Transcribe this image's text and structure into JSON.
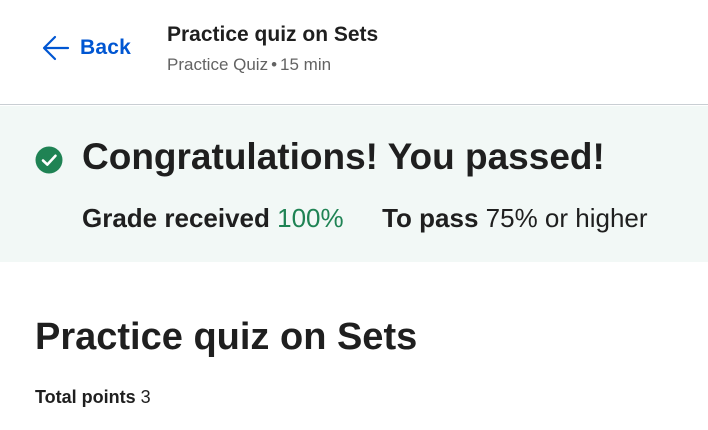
{
  "header": {
    "back_label": "Back",
    "title": "Practice quiz on Sets",
    "type": "Practice Quiz",
    "separator": "•",
    "duration": "15 min"
  },
  "result": {
    "heading": "Congratulations! You passed!",
    "grade_label": "Grade received",
    "grade_value": "100%",
    "pass_label": "To pass",
    "pass_value": "75% or higher"
  },
  "quiz": {
    "title": "Practice quiz on Sets",
    "points_label": "Total points",
    "points_value": "3"
  },
  "colors": {
    "link_blue": "#0056d2",
    "success_green": "#1f8354",
    "banner_bg": "#f2f8f6"
  },
  "icons": {
    "back": "arrow-left-icon",
    "passed": "check-circle-icon"
  }
}
